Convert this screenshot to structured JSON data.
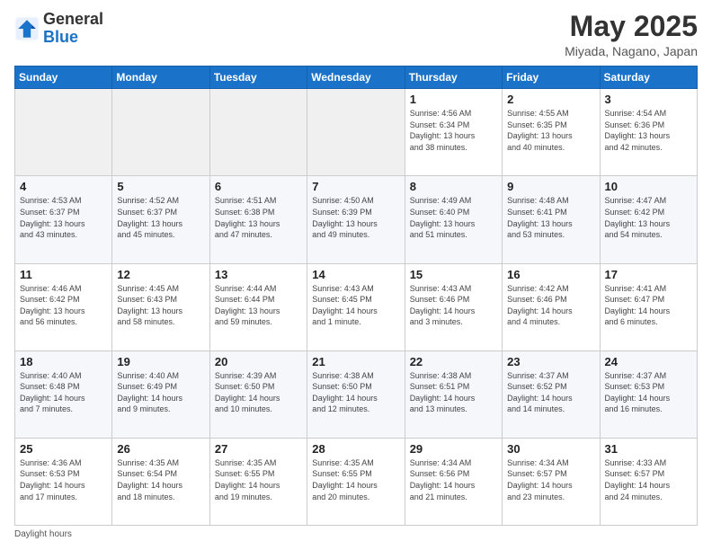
{
  "header": {
    "logo_line1": "General",
    "logo_line2": "Blue",
    "month_title": "May 2025",
    "location": "Miyada, Nagano, Japan"
  },
  "days_of_week": [
    "Sunday",
    "Monday",
    "Tuesday",
    "Wednesday",
    "Thursday",
    "Friday",
    "Saturday"
  ],
  "footer": {
    "daylight_hours_label": "Daylight hours"
  },
  "weeks": [
    [
      {
        "day": "",
        "info": ""
      },
      {
        "day": "",
        "info": ""
      },
      {
        "day": "",
        "info": ""
      },
      {
        "day": "",
        "info": ""
      },
      {
        "day": "1",
        "info": "Sunrise: 4:56 AM\nSunset: 6:34 PM\nDaylight: 13 hours\nand 38 minutes."
      },
      {
        "day": "2",
        "info": "Sunrise: 4:55 AM\nSunset: 6:35 PM\nDaylight: 13 hours\nand 40 minutes."
      },
      {
        "day": "3",
        "info": "Sunrise: 4:54 AM\nSunset: 6:36 PM\nDaylight: 13 hours\nand 42 minutes."
      }
    ],
    [
      {
        "day": "4",
        "info": "Sunrise: 4:53 AM\nSunset: 6:37 PM\nDaylight: 13 hours\nand 43 minutes."
      },
      {
        "day": "5",
        "info": "Sunrise: 4:52 AM\nSunset: 6:37 PM\nDaylight: 13 hours\nand 45 minutes."
      },
      {
        "day": "6",
        "info": "Sunrise: 4:51 AM\nSunset: 6:38 PM\nDaylight: 13 hours\nand 47 minutes."
      },
      {
        "day": "7",
        "info": "Sunrise: 4:50 AM\nSunset: 6:39 PM\nDaylight: 13 hours\nand 49 minutes."
      },
      {
        "day": "8",
        "info": "Sunrise: 4:49 AM\nSunset: 6:40 PM\nDaylight: 13 hours\nand 51 minutes."
      },
      {
        "day": "9",
        "info": "Sunrise: 4:48 AM\nSunset: 6:41 PM\nDaylight: 13 hours\nand 53 minutes."
      },
      {
        "day": "10",
        "info": "Sunrise: 4:47 AM\nSunset: 6:42 PM\nDaylight: 13 hours\nand 54 minutes."
      }
    ],
    [
      {
        "day": "11",
        "info": "Sunrise: 4:46 AM\nSunset: 6:42 PM\nDaylight: 13 hours\nand 56 minutes."
      },
      {
        "day": "12",
        "info": "Sunrise: 4:45 AM\nSunset: 6:43 PM\nDaylight: 13 hours\nand 58 minutes."
      },
      {
        "day": "13",
        "info": "Sunrise: 4:44 AM\nSunset: 6:44 PM\nDaylight: 13 hours\nand 59 minutes."
      },
      {
        "day": "14",
        "info": "Sunrise: 4:43 AM\nSunset: 6:45 PM\nDaylight: 14 hours\nand 1 minute."
      },
      {
        "day": "15",
        "info": "Sunrise: 4:43 AM\nSunset: 6:46 PM\nDaylight: 14 hours\nand 3 minutes."
      },
      {
        "day": "16",
        "info": "Sunrise: 4:42 AM\nSunset: 6:46 PM\nDaylight: 14 hours\nand 4 minutes."
      },
      {
        "day": "17",
        "info": "Sunrise: 4:41 AM\nSunset: 6:47 PM\nDaylight: 14 hours\nand 6 minutes."
      }
    ],
    [
      {
        "day": "18",
        "info": "Sunrise: 4:40 AM\nSunset: 6:48 PM\nDaylight: 14 hours\nand 7 minutes."
      },
      {
        "day": "19",
        "info": "Sunrise: 4:40 AM\nSunset: 6:49 PM\nDaylight: 14 hours\nand 9 minutes."
      },
      {
        "day": "20",
        "info": "Sunrise: 4:39 AM\nSunset: 6:50 PM\nDaylight: 14 hours\nand 10 minutes."
      },
      {
        "day": "21",
        "info": "Sunrise: 4:38 AM\nSunset: 6:50 PM\nDaylight: 14 hours\nand 12 minutes."
      },
      {
        "day": "22",
        "info": "Sunrise: 4:38 AM\nSunset: 6:51 PM\nDaylight: 14 hours\nand 13 minutes."
      },
      {
        "day": "23",
        "info": "Sunrise: 4:37 AM\nSunset: 6:52 PM\nDaylight: 14 hours\nand 14 minutes."
      },
      {
        "day": "24",
        "info": "Sunrise: 4:37 AM\nSunset: 6:53 PM\nDaylight: 14 hours\nand 16 minutes."
      }
    ],
    [
      {
        "day": "25",
        "info": "Sunrise: 4:36 AM\nSunset: 6:53 PM\nDaylight: 14 hours\nand 17 minutes."
      },
      {
        "day": "26",
        "info": "Sunrise: 4:35 AM\nSunset: 6:54 PM\nDaylight: 14 hours\nand 18 minutes."
      },
      {
        "day": "27",
        "info": "Sunrise: 4:35 AM\nSunset: 6:55 PM\nDaylight: 14 hours\nand 19 minutes."
      },
      {
        "day": "28",
        "info": "Sunrise: 4:35 AM\nSunset: 6:55 PM\nDaylight: 14 hours\nand 20 minutes."
      },
      {
        "day": "29",
        "info": "Sunrise: 4:34 AM\nSunset: 6:56 PM\nDaylight: 14 hours\nand 21 minutes."
      },
      {
        "day": "30",
        "info": "Sunrise: 4:34 AM\nSunset: 6:57 PM\nDaylight: 14 hours\nand 23 minutes."
      },
      {
        "day": "31",
        "info": "Sunrise: 4:33 AM\nSunset: 6:57 PM\nDaylight: 14 hours\nand 24 minutes."
      }
    ]
  ]
}
